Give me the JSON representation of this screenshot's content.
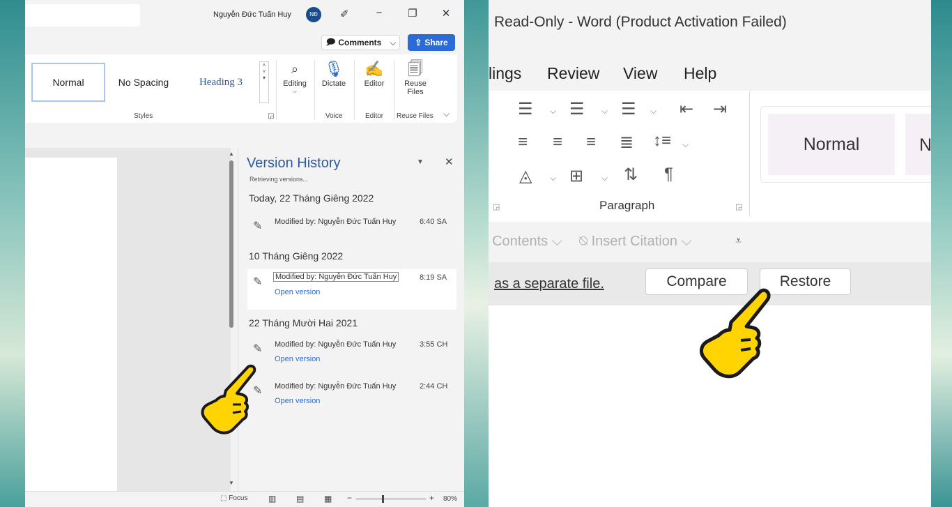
{
  "left": {
    "user_name": "Nguyễn Đức Tuấn Huy",
    "avatar_initials": "NĐ",
    "comments_label": "Comments",
    "share_label": "Share",
    "styles": {
      "normal": "Normal",
      "no_spacing": "No Spacing",
      "heading3": "Heading 3",
      "group_label": "Styles"
    },
    "ribbon": {
      "editing": "Editing",
      "dictate": "Dictate",
      "voice_label": "Voice",
      "editor": "Editor",
      "editor_group": "Editor",
      "reuse_files": "Reuse Files",
      "reuse_files_group": "Reuse Files"
    },
    "version_history": {
      "title": "Version History",
      "status": "Retrieving versions...",
      "groups": [
        {
          "date": "Today, 22 Tháng Giêng 2022"
        },
        {
          "date": "10 Tháng Giêng 2022"
        },
        {
          "date": "22 Tháng Mười Hai 2021"
        }
      ],
      "entries": [
        {
          "modified": "Modified by: Nguyễn Đức Tuấn Huy",
          "time": "6:40 SA",
          "open": ""
        },
        {
          "modified": "Modified by: Nguyễn Đức Tuấn Huy",
          "time": "8:19 SA",
          "open": "Open version"
        },
        {
          "modified": "Modified by: Nguyễn Đức Tuấn Huy",
          "time": "3:55 CH",
          "open": "Open version"
        },
        {
          "modified": "Modified by: Nguyễn Đức Tuấn Huy",
          "time": "2:44 CH",
          "open": "Open version"
        }
      ]
    },
    "status": {
      "focus": "Focus",
      "zoom": "80%"
    }
  },
  "right": {
    "title": "Read-Only  -  Word (Product Activation Failed)",
    "menu": {
      "mailings": "lings",
      "review": "Review",
      "view": "View",
      "help": "Help"
    },
    "paragraph_label": "Paragraph",
    "style_normal": "Normal",
    "style_next": "N",
    "refs": {
      "toc": "f Contents",
      "insert_citation": "Insert Citation"
    },
    "infobar": {
      "save_link": "as a separate file.",
      "compare": "Compare",
      "restore": "Restore"
    }
  },
  "colors": {
    "accent": "#2b6bd6",
    "vh_title": "#2b5aa3",
    "hand_fill": "#ffd400"
  }
}
